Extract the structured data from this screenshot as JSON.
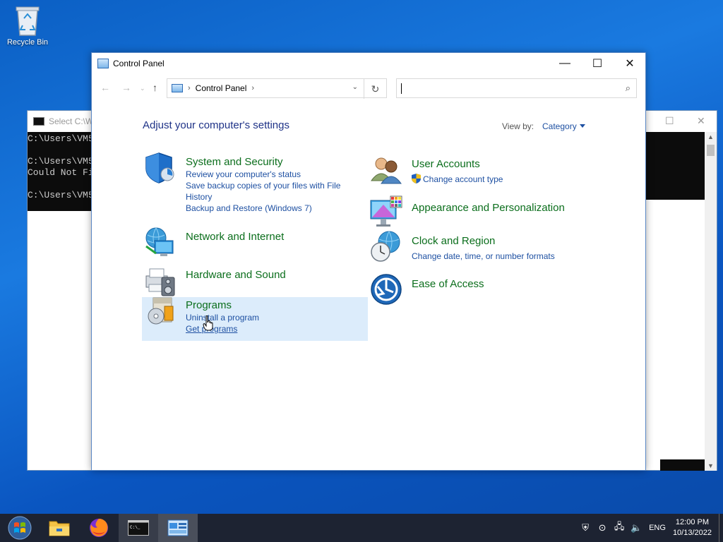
{
  "desktop": {
    "recycle_bin_label": "Recycle Bin"
  },
  "cmd_window": {
    "title": "Select C:\\W",
    "lines": [
      "C:\\Users\\VM5",
      "",
      "C:\\Users\\VM5",
      "Could Not Fi",
      "",
      "C:\\Users\\VM5"
    ]
  },
  "control_panel": {
    "title": "Control Panel",
    "breadcrumb": "Control Panel",
    "search_placeholder": "",
    "heading": "Adjust your computer's settings",
    "view_by_label": "View by:",
    "view_by_value": "Category",
    "categories": [
      {
        "title": "System and Security",
        "icon": "shield-icon",
        "links": [
          "Review your computer's status",
          "Save backup copies of your files with File History",
          "Backup and Restore (Windows 7)"
        ]
      },
      {
        "title": "Network and Internet",
        "icon": "network-globe-icon",
        "links": []
      },
      {
        "title": "Hardware and Sound",
        "icon": "printer-speaker-icon",
        "links": []
      },
      {
        "title": "Programs",
        "icon": "programs-disc-icon",
        "links": [
          "Uninstall a program",
          "Get programs"
        ]
      },
      {
        "title": "User Accounts",
        "icon": "users-icon",
        "links": [
          "Change account type"
        ]
      },
      {
        "title": "Appearance and Personalization",
        "icon": "monitor-palette-icon",
        "links": []
      },
      {
        "title": "Clock and Region",
        "icon": "clock-globe-icon",
        "links": [
          "Change date, time, or number formats"
        ]
      },
      {
        "title": "Ease of Access",
        "icon": "ease-of-access-icon",
        "links": []
      }
    ]
  },
  "taskbar": {
    "language": "ENG",
    "time": "12:00 PM",
    "date": "10/13/2022",
    "pinned": [
      "start-orb-icon",
      "file-explorer-icon",
      "firefox-icon",
      "cmd-icon",
      "control-panel-icon"
    ]
  },
  "colors": {
    "heading": "#1e3287",
    "category_title": "#0b6e1c",
    "link": "#1e50a2",
    "hover_highlight": "#dcecfb",
    "taskbar": "#1d2332"
  }
}
